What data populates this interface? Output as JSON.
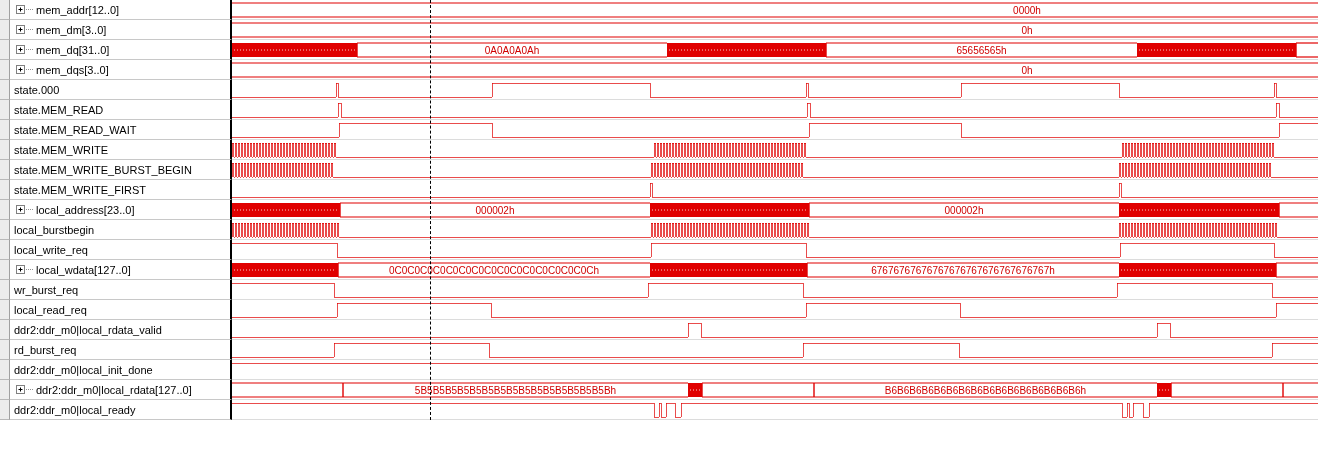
{
  "signals": [
    {
      "name": "mem_addr[12..0]",
      "kind": "bus",
      "expanded": false,
      "values": [
        "0000h"
      ]
    },
    {
      "name": "mem_dm[3..0]",
      "kind": "bus",
      "expanded": false,
      "values": [
        "0h"
      ]
    },
    {
      "name": "mem_dq[31..0]",
      "kind": "bus",
      "expanded": false,
      "values": [
        "0A0A0A0Ah",
        "65656565h"
      ]
    },
    {
      "name": "mem_dqs[3..0]",
      "kind": "bus",
      "expanded": false,
      "values": [
        "0h"
      ]
    },
    {
      "name": "state.000",
      "kind": "bit"
    },
    {
      "name": "state.MEM_READ",
      "kind": "bit"
    },
    {
      "name": "state.MEM_READ_WAIT",
      "kind": "bit"
    },
    {
      "name": "state.MEM_WRITE",
      "kind": "bit"
    },
    {
      "name": "state.MEM_WRITE_BURST_BEGIN",
      "kind": "bit"
    },
    {
      "name": "state.MEM_WRITE_FIRST",
      "kind": "bit"
    },
    {
      "name": "local_address[23..0]",
      "kind": "bus",
      "expanded": false,
      "values": [
        "000002h",
        "000002h"
      ]
    },
    {
      "name": "local_burstbegin",
      "kind": "bit"
    },
    {
      "name": "local_write_req",
      "kind": "bit"
    },
    {
      "name": "local_wdata[127..0]",
      "kind": "bus",
      "expanded": false,
      "values": [
        "0C0C0C0C0C0C0C0C0C0C0C0C0C0C0C0Ch",
        "67676767676767676767676767676767h"
      ]
    },
    {
      "name": "wr_burst_req",
      "kind": "bit"
    },
    {
      "name": "local_read_req",
      "kind": "bit"
    },
    {
      "name": "ddr2:ddr_m0|local_rdata_valid",
      "kind": "bit"
    },
    {
      "name": "rd_burst_req",
      "kind": "bit"
    },
    {
      "name": "ddr2:ddr_m0|local_init_done",
      "kind": "bit"
    },
    {
      "name": "ddr2:ddr_m0|local_rdata[127..0]",
      "kind": "bus",
      "expanded": false,
      "values": [
        "5B5B5B5B5B5B5B5B5B5B5B5B5B5B5B5Bh",
        "B6B6B6B6B6B6B6B6B6B6B6B6B6B6B6B6h"
      ]
    },
    {
      "name": "ddr2:ddr_m0|local_ready",
      "kind": "bit"
    }
  ]
}
